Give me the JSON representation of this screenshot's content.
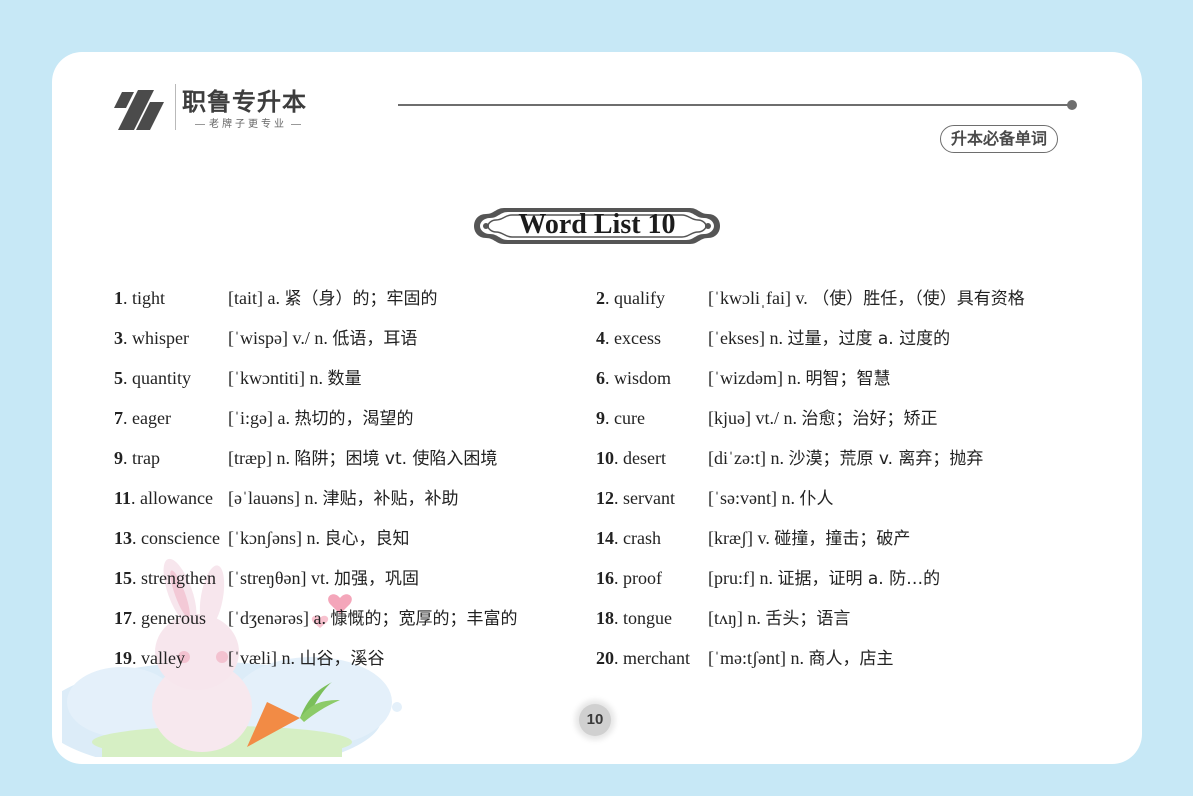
{
  "header": {
    "logo_name": "职鲁专升本",
    "logo_slogan": "老牌子更专业",
    "badge": "升本必备单词"
  },
  "title": "Word List 10",
  "page_number": "10",
  "entries": [
    {
      "num": "1",
      "word": "tight",
      "phonetic": "[tait]",
      "def_pos": "a.",
      "def_zh": "紧（身）的；牢固的"
    },
    {
      "num": "2",
      "word": "qualify",
      "phonetic": "[ˈkwɔliˌfai]",
      "def_pos": "v.",
      "def_zh": "（使）胜任，（使）具有资格"
    },
    {
      "num": "3",
      "word": "whisper",
      "phonetic": "[ˈwispə]",
      "def_pos": "v./ n.",
      "def_zh": "低语，耳语"
    },
    {
      "num": "4",
      "word": "excess",
      "phonetic": "[ˈekses]",
      "def_pos": "n.",
      "def_zh": "过量，过度 a. 过度的"
    },
    {
      "num": "5",
      "word": "quantity",
      "phonetic": "[ˈkwɔntiti]",
      "def_pos": "n.",
      "def_zh": "数量"
    },
    {
      "num": "6",
      "word": "wisdom",
      "phonetic": "[ˈwizdəm]",
      "def_pos": "n.",
      "def_zh": "明智；智慧"
    },
    {
      "num": "7",
      "word": "eager",
      "phonetic": "[ˈi:gə]",
      "def_pos": "a.",
      "def_zh": "热切的，渴望的"
    },
    {
      "num": "9",
      "word": "cure",
      "phonetic": "[kjuə]",
      "def_pos": "vt./ n.",
      "def_zh": "治愈；治好；矫正"
    },
    {
      "num": "9",
      "word": "trap",
      "phonetic": "[træp]",
      "def_pos": "n.",
      "def_zh": "陷阱；困境 vt. 使陷入困境"
    },
    {
      "num": "10",
      "word": "desert",
      "phonetic": "[diˈzə:t]",
      "def_pos": "n.",
      "def_zh": "沙漠；荒原 v. 离弃；抛弃"
    },
    {
      "num": "11",
      "word": "allowance",
      "phonetic": "[əˈlauəns]",
      "def_pos": "n.",
      "def_zh": "津贴，补贴，补助"
    },
    {
      "num": "12",
      "word": "servant",
      "phonetic": "[ˈsə:vənt]",
      "def_pos": "n.",
      "def_zh": "仆人"
    },
    {
      "num": "13",
      "word": "conscience",
      "phonetic": "[ˈkɔnʃəns]",
      "def_pos": "n.",
      "def_zh": "良心，良知"
    },
    {
      "num": "14",
      "word": "crash",
      "phonetic": "[kræʃ]",
      "def_pos": "v.",
      "def_zh": "碰撞，撞击；破产"
    },
    {
      "num": "15",
      "word": "strengthen",
      "phonetic": "[ˈstreŋθən]",
      "def_pos": "vt.",
      "def_zh": "加强，巩固"
    },
    {
      "num": "16",
      "word": "proof",
      "phonetic": "[pru:f]",
      "def_pos": "n.",
      "def_zh": "证据，证明 a. 防…的"
    },
    {
      "num": "17",
      "word": "generous",
      "phonetic": "[ˈdʒenərəs]",
      "def_pos": "a.",
      "def_zh": "慷慨的；宽厚的；丰富的"
    },
    {
      "num": "18",
      "word": "tongue",
      "phonetic": "[tʌŋ]",
      "def_pos": "n.",
      "def_zh": "舌头；语言"
    },
    {
      "num": "19",
      "word": "valley",
      "phonetic": "[ˈvæli]",
      "def_pos": "n.",
      "def_zh": "山谷，溪谷"
    },
    {
      "num": "20",
      "word": "merchant",
      "phonetic": "[ˈmə:tʃənt]",
      "def_pos": "n.",
      "def_zh": "商人，店主"
    }
  ]
}
